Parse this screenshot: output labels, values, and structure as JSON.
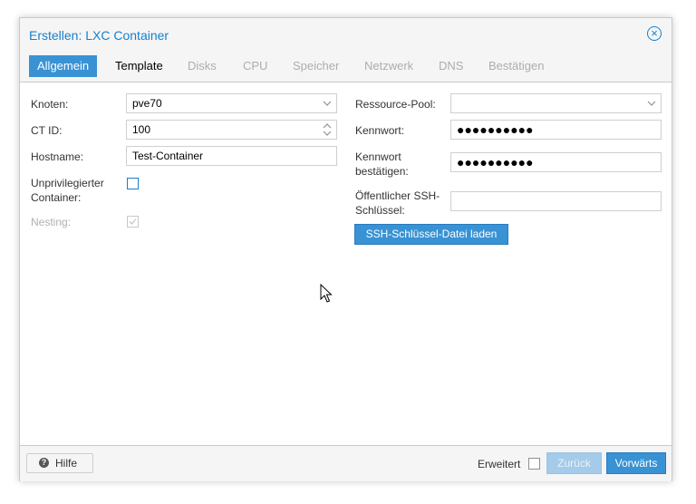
{
  "dialog": {
    "title": "Erstellen: LXC Container",
    "close_icon_glyph": "×"
  },
  "tabs": [
    {
      "label": "Allgemein",
      "state": "active"
    },
    {
      "label": "Template",
      "state": "enabled"
    },
    {
      "label": "Disks",
      "state": "disabled"
    },
    {
      "label": "CPU",
      "state": "disabled"
    },
    {
      "label": "Speicher",
      "state": "disabled"
    },
    {
      "label": "Netzwerk",
      "state": "disabled"
    },
    {
      "label": "DNS",
      "state": "disabled"
    },
    {
      "label": "Bestätigen",
      "state": "disabled"
    }
  ],
  "left": {
    "node_label": "Knoten:",
    "node_value": "pve70",
    "ctid_label": "CT ID:",
    "ctid_value": "100",
    "hostname_label": "Hostname:",
    "hostname_value": "Test-Container",
    "unpriv_label_line1": "Unprivilegierter",
    "unpriv_label_line2": "Container:",
    "unpriv_checked": false,
    "nesting_label": "Nesting:",
    "nesting_checked": true,
    "nesting_disabled": true
  },
  "right": {
    "pool_label": "Ressource-Pool:",
    "pool_value": "",
    "password_label": "Kennwort:",
    "password_mask": "●●●●●●●●●●",
    "confirm_label_line1": "Kennwort",
    "confirm_label_line2": "bestätigen:",
    "confirm_mask": "●●●●●●●●●●",
    "ssh_label_line1": "Öffentlicher SSH-",
    "ssh_label_line2": "Schlüssel:",
    "ssh_value": "",
    "ssh_load_button": "SSH-Schlüssel-Datei laden"
  },
  "footer": {
    "help_label": "Hilfe",
    "help_icon_glyph": "?",
    "advanced_label": "Erweitert",
    "advanced_checked": false,
    "back_label": "Zurück",
    "back_disabled": true,
    "next_label": "Vorwärts"
  },
  "icons": {
    "close": "close-circle-icon",
    "combo": "chevron-down-icon",
    "spinner": "spinner-arrows-icon",
    "help": "question-circle-icon",
    "cursor": "mouse-pointer-icon"
  },
  "colors": {
    "accent": "#157fcc",
    "button": "#3892d4",
    "button_disabled": "#a4cbe9",
    "disabled_text": "#adadad"
  }
}
